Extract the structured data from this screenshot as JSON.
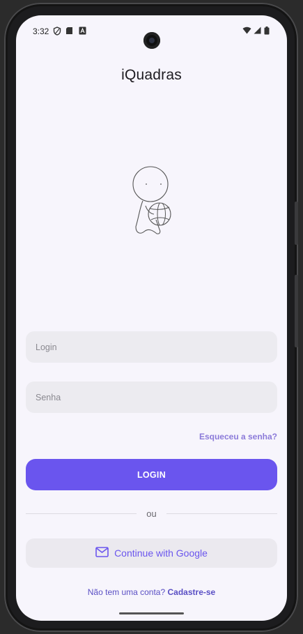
{
  "status_bar": {
    "time": "3:32",
    "left_icons": [
      "shield-icon",
      "sd-card-icon",
      "a-badge-icon"
    ],
    "right_icons": [
      "wifi-icon",
      "signal-icon",
      "battery-icon"
    ]
  },
  "app": {
    "title": "iQuadras"
  },
  "form": {
    "login_placeholder": "Login",
    "password_placeholder": "Senha",
    "forgot_password": "Esqueceu a senha?",
    "login_button": "LOGIN",
    "divider_text": "ou",
    "google_button": "Continue with Google"
  },
  "footer": {
    "no_account_text": "Não tem uma conta?",
    "signup_link": "Cadastre-se"
  },
  "colors": {
    "accent": "#6a55ee",
    "background": "#f7f5fc",
    "field_background": "#ecebf0",
    "link": "#8b7ad9"
  }
}
